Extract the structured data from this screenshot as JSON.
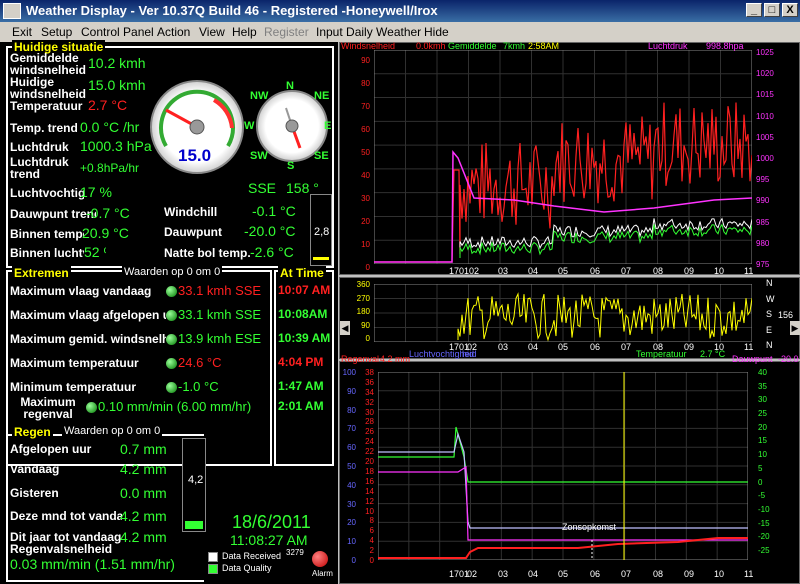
{
  "window": {
    "title": "Weather Display - Ver 10.37Q Build 46 - Registered  -Honeywell/Irox",
    "min": "_",
    "max": "□",
    "close": "X"
  },
  "menu": [
    {
      "label": "Exit",
      "enabled": true
    },
    {
      "label": "Setup",
      "enabled": true
    },
    {
      "label": "Control Panel",
      "enabled": true
    },
    {
      "label": "Action",
      "enabled": true
    },
    {
      "label": "View",
      "enabled": true
    },
    {
      "label": "Help",
      "enabled": true
    },
    {
      "label": "Register",
      "enabled": false
    },
    {
      "label": "Input Daily Weather",
      "enabled": true
    },
    {
      "label": "Hide",
      "enabled": true
    }
  ],
  "current": {
    "header": "Huidige situatie",
    "avg_wind_label": "Gemiddelde windsnelheid",
    "avg_wind": "10.2 kmh",
    "wind_label": "Huidige windsnelheid",
    "wind": "15.0 kmh",
    "temp_label": "Temperatuur",
    "temp": "2.7 °C",
    "temp_trend_label": "Temp. trend",
    "temp_trend": "0.0 °C /hr",
    "pressure_label": "Luchtdruk",
    "pressure": "1000.3 hPa",
    "pressure_trend_label": "Luchtdruk trend",
    "pressure_trend": "+0.8hPa/hr",
    "humidity_label": "Luchtvochtigheid",
    "humidity": "17 %",
    "dew_trend_label": "Dauwpunt trend",
    "dew_trend": "-0.7 °C",
    "inside_temp_label": "Binnen temperatuur",
    "inside_temp": "20.9 °C",
    "inside_hum_label": "Binnen luchtvochtigheid",
    "inside_hum": "52 %",
    "windchill_label": "Windchill",
    "windchill": "-0.1 °C",
    "dewpoint_label": "Dauwpunt",
    "dewpoint": "-20.0 °C",
    "wetbulb_label": "Natte bol temp.",
    "wetbulb": "-2.6 °C",
    "gauge_value": "15.0",
    "compass": {
      "N": "N",
      "NE": "NE",
      "E": "E",
      "SE": "SE",
      "S": "S",
      "SW": "SW",
      "W": "W",
      "NW": "NW"
    },
    "wind_dir": "SSE",
    "wind_deg": "158 °",
    "small_bar": "2,8"
  },
  "extremes": {
    "header": "Extremen",
    "sub": "Waarden op 0 om 0",
    "time_header": "At Time",
    "rows": [
      {
        "label": "Maximum vlaag vandaag",
        "value": "33.1 kmh SSE",
        "time": "10:07 AM",
        "vcolor": "red",
        "tcolor": "red"
      },
      {
        "label": "Maximum vlaag afgelopen uur",
        "value": "33.1 kmh SSE",
        "time": "10:08AM",
        "vcolor": "gr",
        "tcolor": "gr"
      },
      {
        "label": "Maximum gemid. windsnelheid",
        "value": "13.9 kmh ESE",
        "time": "10:39 AM",
        "vcolor": "gr",
        "tcolor": "gr"
      },
      {
        "label": "Maximum temperatuur",
        "value": "24.6 °C",
        "time": "4:04 PM",
        "vcolor": "red",
        "tcolor": "red"
      },
      {
        "label": "Minimum temperatuur",
        "value": "-1.0 °C",
        "time": "1:47 AM",
        "vcolor": "gr",
        "tcolor": "gr"
      },
      {
        "label": "Maximum regenval",
        "value": "0.10 mm/min (6.00 mm/hr)",
        "time": "2:01 AM",
        "vcolor": "gr",
        "tcolor": "gr"
      }
    ]
  },
  "rain": {
    "header": "Regen",
    "sub": "Waarden op 0 om 0",
    "rows": [
      {
        "label": "Afgelopen uur",
        "value": "0.7 mm"
      },
      {
        "label": "Vandaag",
        "value": "4.2 mm"
      },
      {
        "label": "Gisteren",
        "value": "0.0 mm"
      },
      {
        "label": "Deze mnd tot vandaag",
        "value": "4.2 mm"
      },
      {
        "label": "Dit jaar tot vandaag",
        "value": "4.2 mm"
      }
    ],
    "rate_label": "Regenvalsnelheid",
    "rate": "0.03 mm/min (1.51 mm/hr)",
    "bar_value": "4,2"
  },
  "status": {
    "date": "18/6/2011",
    "time": "11:08:27 AM",
    "data_received": "Data Received",
    "received_count": "3279",
    "data_quality": "Data Quality",
    "alarm": "Alarm"
  },
  "graph1": {
    "label_wind": "Windsnelheid",
    "wind_val": "0.0kmh",
    "label_avg": "Gemiddelde",
    "avg_val": "7kmh",
    "time": "2:58AM",
    "label_pressure": "Luchtdruk",
    "pressure_val": "998.8hpa",
    "left_axis": [
      "90",
      "80",
      "70",
      "60",
      "50",
      "40",
      "30",
      "20",
      "10",
      "0"
    ],
    "right_axis": [
      "1025",
      "1020",
      "1015",
      "1010",
      "1005",
      "1000",
      "995",
      "990",
      "985",
      "980",
      "975"
    ],
    "x_labels": [
      "17",
      "01",
      "02",
      "03",
      "04",
      "05",
      "06",
      "07",
      "08",
      "09",
      "10",
      "11"
    ]
  },
  "graph2": {
    "left_axis": [
      "360",
      "270",
      "180",
      "90",
      "0"
    ],
    "right_axis": [
      "N",
      "W",
      "S",
      "E",
      "N"
    ],
    "right_value": "156",
    "x_labels": [
      "17",
      "01",
      "02",
      "03",
      "04",
      "05",
      "06",
      "07",
      "08",
      "09",
      "10",
      "11"
    ]
  },
  "graph3": {
    "label_rain": "Regenval",
    "rain_val": "4.2 mm",
    "label_hum": "Luchtvochtigheid",
    "label_hum2": "hid",
    "label_temp": "Temperatuur",
    "temp_val": "2.7 °C",
    "label_dew": "Dauwpunt",
    "dew_val": "-20.0",
    "sunrise": "Zonsopkomst",
    "left_axis": [
      "100",
      "90",
      "80",
      "70",
      "60",
      "50",
      "40",
      "30",
      "20",
      "10",
      "0"
    ],
    "left_axis2": [
      "38",
      "36",
      "34",
      "32",
      "30",
      "28",
      "26",
      "24",
      "22",
      "20",
      "18",
      "16",
      "14",
      "12",
      "10",
      "8",
      "6",
      "4",
      "2",
      "0"
    ],
    "right_axis": [
      "40",
      "35",
      "30",
      "25",
      "20",
      "15",
      "10",
      "5",
      "0",
      "-5",
      "-10",
      "-15",
      "-20",
      "-25"
    ],
    "x_labels": [
      "17",
      "01",
      "02",
      "03",
      "04",
      "05",
      "06",
      "07",
      "08",
      "09",
      "10",
      "11"
    ]
  },
  "colors": {
    "green": "#33ff33",
    "red": "#ff2020",
    "yellow": "#ffff00",
    "magenta": "#ff33ff",
    "blue": "#6666ff"
  }
}
